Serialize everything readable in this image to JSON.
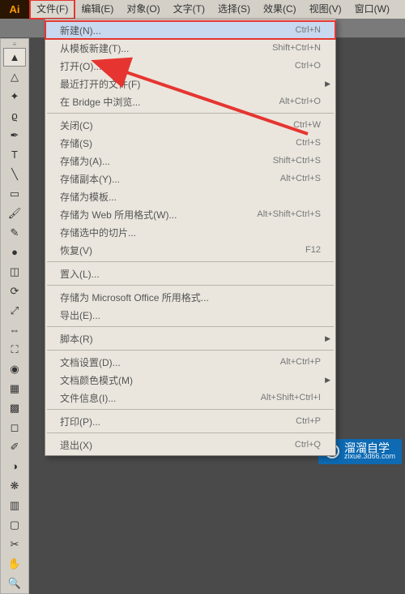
{
  "app": {
    "logo": "Ai"
  },
  "menubar": [
    {
      "label": "文件(F)",
      "active": true
    },
    {
      "label": "编辑(E)"
    },
    {
      "label": "对象(O)"
    },
    {
      "label": "文字(T)"
    },
    {
      "label": "选择(S)"
    },
    {
      "label": "效果(C)"
    },
    {
      "label": "视图(V)"
    },
    {
      "label": "窗口(W)"
    }
  ],
  "dropdown": [
    {
      "label": "新建(N)...",
      "shortcut": "Ctrl+N",
      "highlight": true
    },
    {
      "label": "从模板新建(T)...",
      "shortcut": "Shift+Ctrl+N"
    },
    {
      "label": "打开(O)...",
      "shortcut": "Ctrl+O"
    },
    {
      "label": "最近打开的文件(F)",
      "submenu": true
    },
    {
      "label": "在 Bridge 中浏览...",
      "shortcut": "Alt+Ctrl+O"
    },
    {
      "sep": true
    },
    {
      "label": "关闭(C)",
      "shortcut": "Ctrl+W"
    },
    {
      "label": "存储(S)",
      "shortcut": "Ctrl+S"
    },
    {
      "label": "存储为(A)...",
      "shortcut": "Shift+Ctrl+S"
    },
    {
      "label": "存储副本(Y)...",
      "shortcut": "Alt+Ctrl+S"
    },
    {
      "label": "存储为模板..."
    },
    {
      "label": "存储为 Web 所用格式(W)...",
      "shortcut": "Alt+Shift+Ctrl+S"
    },
    {
      "label": "存储选中的切片..."
    },
    {
      "label": "恢复(V)",
      "shortcut": "F12"
    },
    {
      "sep": true
    },
    {
      "label": "置入(L)..."
    },
    {
      "sep": true
    },
    {
      "label": "存储为 Microsoft Office 所用格式..."
    },
    {
      "label": "导出(E)..."
    },
    {
      "sep": true
    },
    {
      "label": "脚本(R)",
      "submenu": true
    },
    {
      "sep": true
    },
    {
      "label": "文档设置(D)...",
      "shortcut": "Alt+Ctrl+P"
    },
    {
      "label": "文档颜色模式(M)",
      "submenu": true
    },
    {
      "label": "文件信息(I)...",
      "shortcut": "Alt+Shift+Ctrl+I"
    },
    {
      "sep": true
    },
    {
      "label": "打印(P)...",
      "shortcut": "Ctrl+P"
    },
    {
      "sep": true
    },
    {
      "label": "退出(X)",
      "shortcut": "Ctrl+Q"
    }
  ],
  "tools": [
    {
      "name": "selection-tool",
      "glyph": "▲",
      "selected": true
    },
    {
      "name": "direct-selection-tool",
      "glyph": "△"
    },
    {
      "name": "magic-wand-tool",
      "glyph": "✦"
    },
    {
      "name": "lasso-tool",
      "glyph": "ϱ"
    },
    {
      "name": "pen-tool",
      "glyph": "✒"
    },
    {
      "name": "type-tool",
      "glyph": "T"
    },
    {
      "name": "line-tool",
      "glyph": "╲"
    },
    {
      "name": "rectangle-tool",
      "glyph": "▭"
    },
    {
      "name": "paintbrush-tool",
      "glyph": "🖌"
    },
    {
      "name": "pencil-tool",
      "glyph": "✎"
    },
    {
      "name": "blob-brush-tool",
      "glyph": "●"
    },
    {
      "name": "eraser-tool",
      "glyph": "◫"
    },
    {
      "name": "rotate-tool",
      "glyph": "⟳"
    },
    {
      "name": "scale-tool",
      "glyph": "⤢"
    },
    {
      "name": "width-tool",
      "glyph": "⇔"
    },
    {
      "name": "free-transform-tool",
      "glyph": "⛶"
    },
    {
      "name": "shape-builder-tool",
      "glyph": "◉"
    },
    {
      "name": "perspective-grid-tool",
      "glyph": "▦"
    },
    {
      "name": "mesh-tool",
      "glyph": "▩"
    },
    {
      "name": "gradient-tool",
      "glyph": "◻"
    },
    {
      "name": "eyedropper-tool",
      "glyph": "✐"
    },
    {
      "name": "blend-tool",
      "glyph": "◑"
    },
    {
      "name": "symbol-sprayer-tool",
      "glyph": "❋"
    },
    {
      "name": "column-graph-tool",
      "glyph": "▥"
    },
    {
      "name": "artboard-tool",
      "glyph": "▢"
    },
    {
      "name": "slice-tool",
      "glyph": "✂"
    },
    {
      "name": "hand-tool",
      "glyph": "✋"
    },
    {
      "name": "zoom-tool",
      "glyph": "🔍"
    }
  ],
  "watermark": {
    "title": "溜溜自学",
    "subtitle": "zixue.3d66.com"
  }
}
